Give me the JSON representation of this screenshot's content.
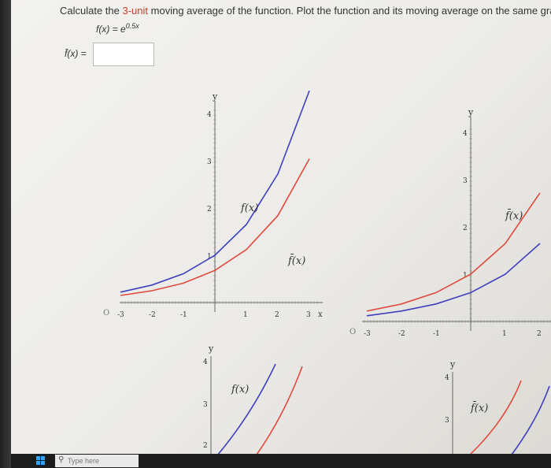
{
  "question": {
    "prefix": "Calculate the ",
    "highlight": "3-unit",
    "suffix": " moving average of the function. Plot the function and its moving average on the same grapl"
  },
  "formula": {
    "lhs": "f(x) = e",
    "exp": "0.5x"
  },
  "answer": {
    "label": "f̄(x) =",
    "value": ""
  },
  "plot_labels": {
    "y_axis": "y",
    "x_axis": "x",
    "f_label": "f(x)",
    "fbar_label": "f̄(x)",
    "origin": "O"
  },
  "colors": {
    "function": "#3f3fbf",
    "moving_average": "#e0493c",
    "highlight": "#c8402f"
  },
  "taskbar": {
    "search_placeholder": "Type here"
  },
  "chart_data": [
    {
      "type": "line",
      "xlim": [
        -3,
        3
      ],
      "ylim": [
        0,
        4
      ],
      "x_ticks": [
        -3,
        -2,
        -1,
        1,
        2,
        3
      ],
      "y_ticks": [
        1,
        2,
        3,
        4
      ],
      "series": [
        {
          "name": "f(x)",
          "x": [
            -3,
            -2,
            -1,
            0,
            1,
            2,
            3
          ],
          "values": [
            0.22,
            0.37,
            0.61,
            1.0,
            1.65,
            2.72,
            4.48
          ]
        },
        {
          "name": "f̄(x)",
          "x": [
            -3,
            -2,
            -1,
            0,
            1,
            2,
            3
          ],
          "values": [
            0.15,
            0.25,
            0.41,
            0.68,
            1.12,
            1.84,
            3.04
          ]
        }
      ]
    },
    {
      "type": "line",
      "xlim": [
        -3,
        2.5
      ],
      "ylim": [
        0,
        4
      ],
      "x_ticks": [
        -3,
        -2,
        -1,
        1,
        2
      ],
      "y_ticks": [
        1,
        2,
        3,
        4
      ],
      "series": [
        {
          "name": "f(x)",
          "x": [
            -3,
            -2,
            -1,
            0,
            1,
            2
          ],
          "values": [
            0.12,
            0.22,
            0.37,
            0.61,
            1.0,
            1.65
          ]
        },
        {
          "name": "f̄(x)",
          "x": [
            -3,
            -2,
            -1,
            0,
            1,
            2
          ],
          "values": [
            0.22,
            0.37,
            0.61,
            1.0,
            1.65,
            2.72
          ]
        }
      ]
    }
  ]
}
